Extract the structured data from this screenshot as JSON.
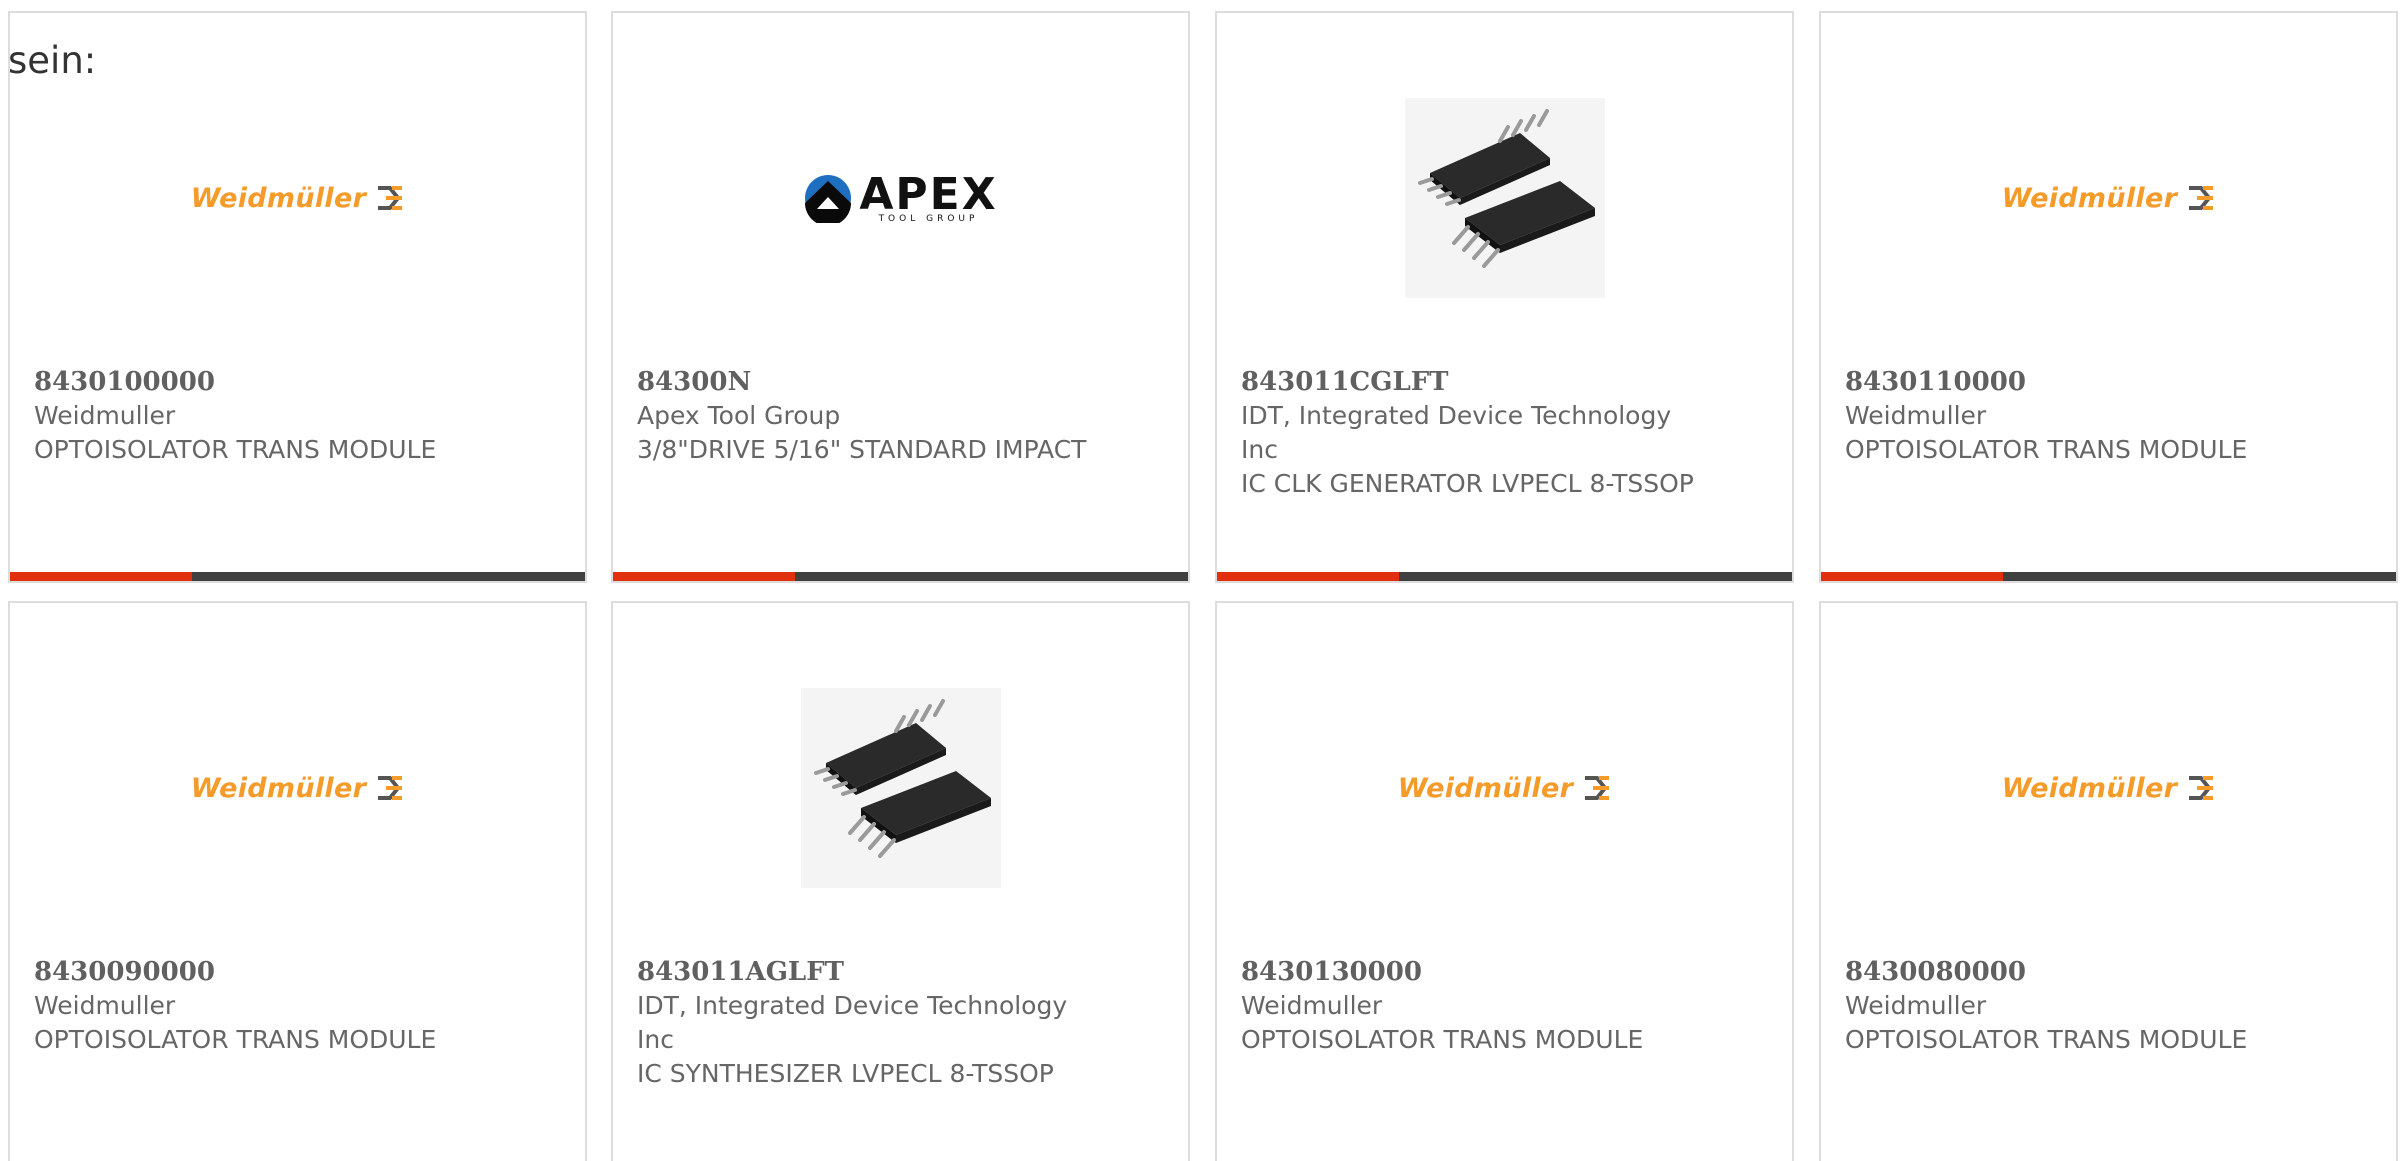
{
  "lead_text": "sein:",
  "brand_colors": {
    "accent": "#e0300d",
    "bar": "#404040",
    "weidmuller": "#f49b2a"
  },
  "products": [
    {
      "part_number": "8430100000",
      "manufacturer": "Weidmuller",
      "description": "OPTOISOLATOR TRANS MODULE",
      "image": "weidmuller-logo",
      "logo_text": "Weidmüller"
    },
    {
      "part_number": "84300N",
      "manufacturer": "Apex Tool Group",
      "description": "3/8\"DRIVE 5/16\" STANDARD IMPACT",
      "image": "apex-tool-group-logo",
      "logo_text": "APEX",
      "logo_subtext": "TOOL GROUP"
    },
    {
      "part_number": "843011CGLFT",
      "manufacturer": "IDT, Integrated Device Technology Inc",
      "description": "IC CLK GENERATOR LVPECL 8-TSSOP",
      "image": "tssop-chip-photo"
    },
    {
      "part_number": "8430110000",
      "manufacturer": "Weidmuller",
      "description": "OPTOISOLATOR TRANS MODULE",
      "image": "weidmuller-logo",
      "logo_text": "Weidmüller"
    },
    {
      "part_number": "8430090000",
      "manufacturer": "Weidmuller",
      "description": "OPTOISOLATOR TRANS MODULE",
      "image": "weidmuller-logo",
      "logo_text": "Weidmüller"
    },
    {
      "part_number": "843011AGLFT",
      "manufacturer": "IDT, Integrated Device Technology Inc",
      "description": "IC SYNTHESIZER LVPECL 8-TSSOP",
      "image": "tssop-chip-photo"
    },
    {
      "part_number": "8430130000",
      "manufacturer": "Weidmuller",
      "description": "OPTOISOLATOR TRANS MODULE",
      "image": "weidmuller-logo",
      "logo_text": "Weidmüller"
    },
    {
      "part_number": "8430080000",
      "manufacturer": "Weidmuller",
      "description": "OPTOISOLATOR TRANS MODULE",
      "image": "weidmuller-logo",
      "logo_text": "Weidmüller"
    }
  ]
}
